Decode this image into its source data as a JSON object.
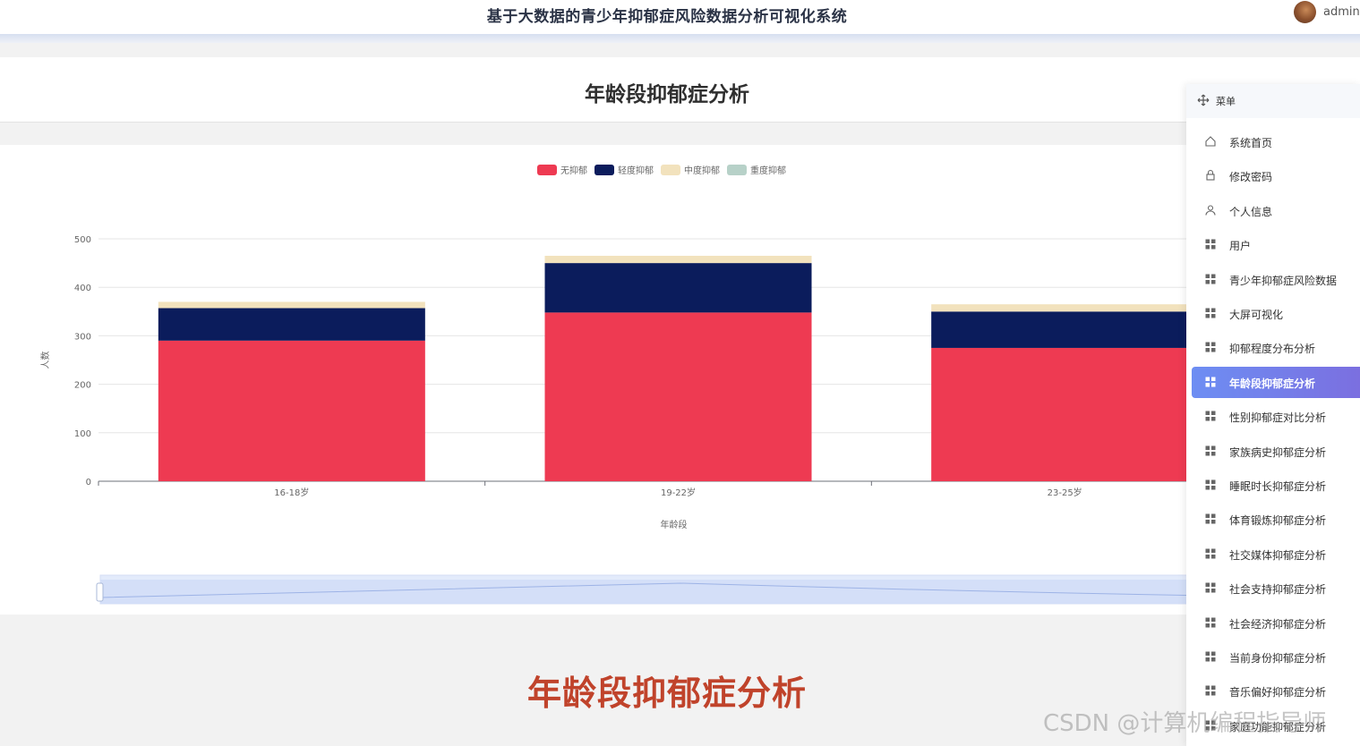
{
  "header": {
    "app_title": "基于大数据的青少年抑郁症风险数据分析可视化系统",
    "username": "admin"
  },
  "page": {
    "title": "年龄段抑郁症分析"
  },
  "chart_data": {
    "type": "bar",
    "stacked": true,
    "categories": [
      "16-18岁",
      "19-22岁",
      "23-25岁"
    ],
    "series": [
      {
        "name": "无抑郁",
        "color": "#ee3a52",
        "values": [
          290,
          348,
          275
        ]
      },
      {
        "name": "轻度抑郁",
        "color": "#0b1c5c",
        "values": [
          67,
          102,
          75
        ]
      },
      {
        "name": "中度抑郁",
        "color": "#f2e2bd",
        "values": [
          13,
          15,
          15
        ]
      },
      {
        "name": "重度抑郁",
        "color": "#b7d1c8",
        "values": [
          0,
          0,
          0
        ]
      }
    ],
    "xlabel": "年龄段",
    "ylabel": "人数",
    "ylim": [
      0,
      500
    ],
    "yticks": [
      0,
      100,
      200,
      300,
      400,
      500
    ],
    "legend_position": "top-center",
    "grid": true,
    "datazoom": true
  },
  "sidebar": {
    "title": "菜单",
    "items": [
      {
        "label": "系统首页",
        "icon": "home-icon",
        "active": false
      },
      {
        "label": "修改密码",
        "icon": "lock-icon",
        "active": false
      },
      {
        "label": "个人信息",
        "icon": "user-icon",
        "active": false
      },
      {
        "label": "用户",
        "icon": "grid-icon",
        "active": false
      },
      {
        "label": "青少年抑郁症风险数据",
        "icon": "grid-icon",
        "active": false
      },
      {
        "label": "大屏可视化",
        "icon": "grid-icon",
        "active": false
      },
      {
        "label": "抑郁程度分布分析",
        "icon": "grid-icon",
        "active": false
      },
      {
        "label": "年龄段抑郁症分析",
        "icon": "grid-icon",
        "active": true
      },
      {
        "label": "性别抑郁症对比分析",
        "icon": "grid-icon",
        "active": false
      },
      {
        "label": "家族病史抑郁症分析",
        "icon": "grid-icon",
        "active": false
      },
      {
        "label": "睡眠时长抑郁症分析",
        "icon": "grid-icon",
        "active": false
      },
      {
        "label": "体育锻炼抑郁症分析",
        "icon": "grid-icon",
        "active": false
      },
      {
        "label": "社交媒体抑郁症分析",
        "icon": "grid-icon",
        "active": false
      },
      {
        "label": "社会支持抑郁症分析",
        "icon": "grid-icon",
        "active": false
      },
      {
        "label": "社会经济抑郁症分析",
        "icon": "grid-icon",
        "active": false
      },
      {
        "label": "当前身份抑郁症分析",
        "icon": "grid-icon",
        "active": false
      },
      {
        "label": "音乐偏好抑郁症分析",
        "icon": "grid-icon",
        "active": false
      },
      {
        "label": "家庭功能抑郁症分析",
        "icon": "grid-icon",
        "active": false
      }
    ]
  },
  "caption": "年龄段抑郁症分析",
  "watermark": "CSDN @计算机编程指导师"
}
